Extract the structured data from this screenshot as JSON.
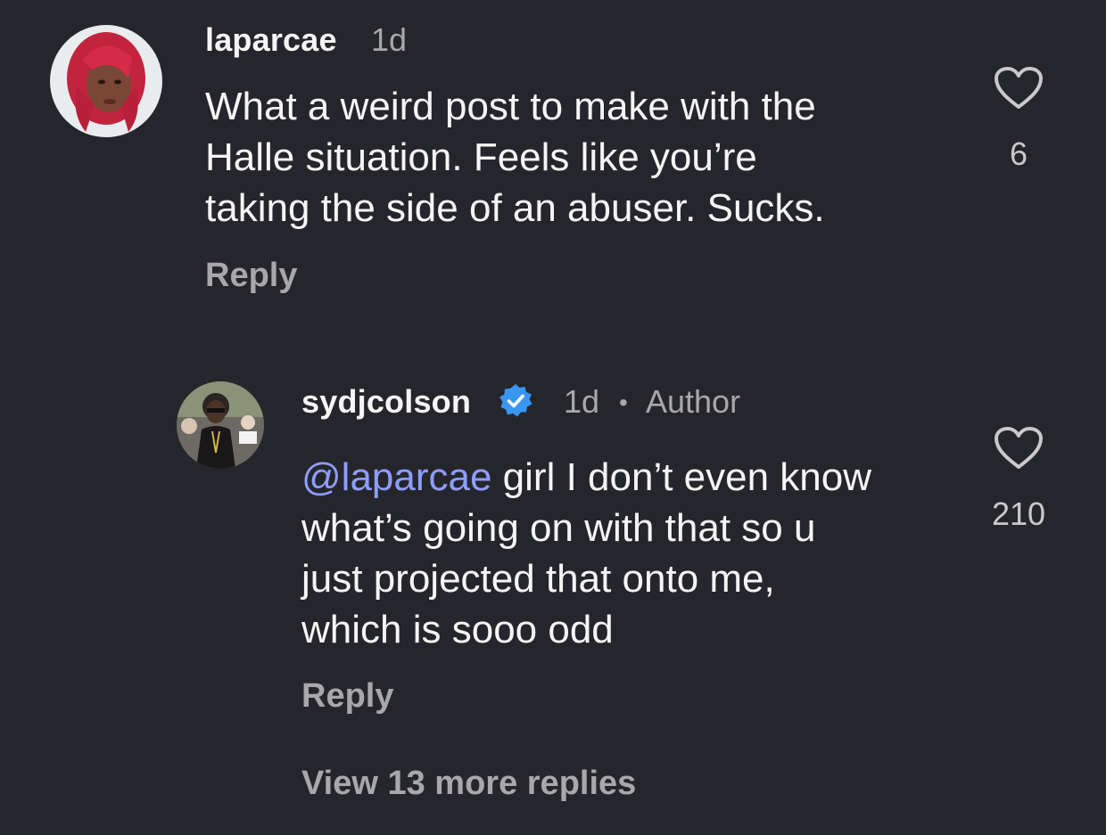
{
  "comment": {
    "username": "laparcae",
    "time": "1d",
    "text": "What a weird post to make with the\nHalle situation. Feels like you’re\ntaking the side of an abuser. Sucks.",
    "likes": "6",
    "reply_label": "Reply",
    "avatar_icon": "user-avatar-red-hair"
  },
  "reply": {
    "username": "sydjcolson",
    "verified_icon": "verified-badge-icon",
    "time": "1d",
    "separator": "•",
    "badge": "Author",
    "mention": "@laparcae",
    "text": " girl I don’t even know\nwhat’s going on with that so u\njust projected that onto me,\nwhich is sooo odd",
    "likes": "210",
    "reply_label": "Reply",
    "avatar_icon": "user-avatar-crowd-photo"
  },
  "view_more": "View 13 more replies",
  "colors": {
    "background": "#25262b",
    "mention": "#8f9dff",
    "verified": "#3897f0",
    "muted": "#a8a8ab"
  }
}
